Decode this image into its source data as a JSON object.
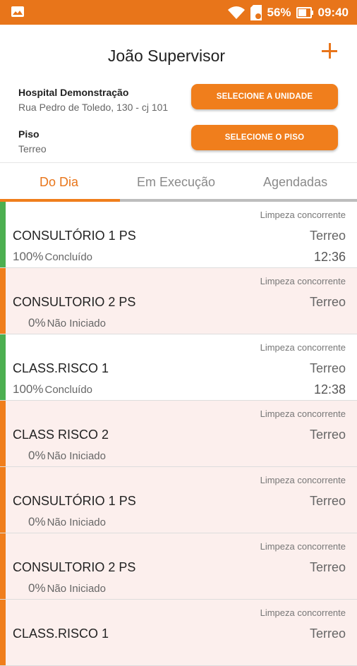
{
  "status_bar": {
    "battery": "56%",
    "time": "09:40",
    "icons": [
      "gallery-icon",
      "wifi-icon",
      "sdcard-icon",
      "battery-icon"
    ]
  },
  "header": {
    "title": "João Supervisor",
    "add_icon": "plus-icon",
    "unit": {
      "label": "Hospital Demonstração",
      "value": "Rua Pedro de Toledo, 130 - cj 101"
    },
    "floor": {
      "label": "Piso",
      "value": "Terreo"
    },
    "select_unit_button": "SELECIONE A UNIDADE",
    "select_floor_button": "SELECIONE O PISO"
  },
  "tabs": [
    {
      "label": "Do Dia",
      "active": true
    },
    {
      "label": "Em Execução",
      "active": false
    },
    {
      "label": "Agendadas",
      "active": false
    }
  ],
  "colors": {
    "accent": "#f07e1c",
    "status_bar": "#e8751a",
    "done": "#4caf50",
    "pending": "#f07e1c",
    "pending_bg": "#fcefed"
  },
  "tasks": [
    {
      "service": "Limpeza concorrente",
      "name": "CONSULTÓRIO 1 PS",
      "floor": "Terreo",
      "percent": "100%",
      "status": "Concluído",
      "time": "12:36",
      "state": "done"
    },
    {
      "service": "Limpeza concorrente",
      "name": "CONSULTORIO 2 PS",
      "floor": "Terreo",
      "percent": "0%",
      "status": "Não Iniciado",
      "time": "",
      "state": "pending"
    },
    {
      "service": "Limpeza concorrente",
      "name": "CLASS.RISCO 1",
      "floor": "Terreo",
      "percent": "100%",
      "status": "Concluído",
      "time": "12:38",
      "state": "done"
    },
    {
      "service": "Limpeza concorrente",
      "name": "CLASS RISCO 2",
      "floor": "Terreo",
      "percent": "0%",
      "status": "Não Iniciado",
      "time": "",
      "state": "pending"
    },
    {
      "service": "Limpeza concorrente",
      "name": "CONSULTÓRIO 1 PS",
      "floor": "Terreo",
      "percent": "0%",
      "status": "Não Iniciado",
      "time": "",
      "state": "pending"
    },
    {
      "service": "Limpeza concorrente",
      "name": "CONSULTORIO 2 PS",
      "floor": "Terreo",
      "percent": "0%",
      "status": "Não Iniciado",
      "time": "",
      "state": "pending"
    },
    {
      "service": "Limpeza concorrente",
      "name": "CLASS.RISCO 1",
      "floor": "Terreo",
      "percent": "",
      "status": "",
      "time": "",
      "state": "pending"
    }
  ]
}
